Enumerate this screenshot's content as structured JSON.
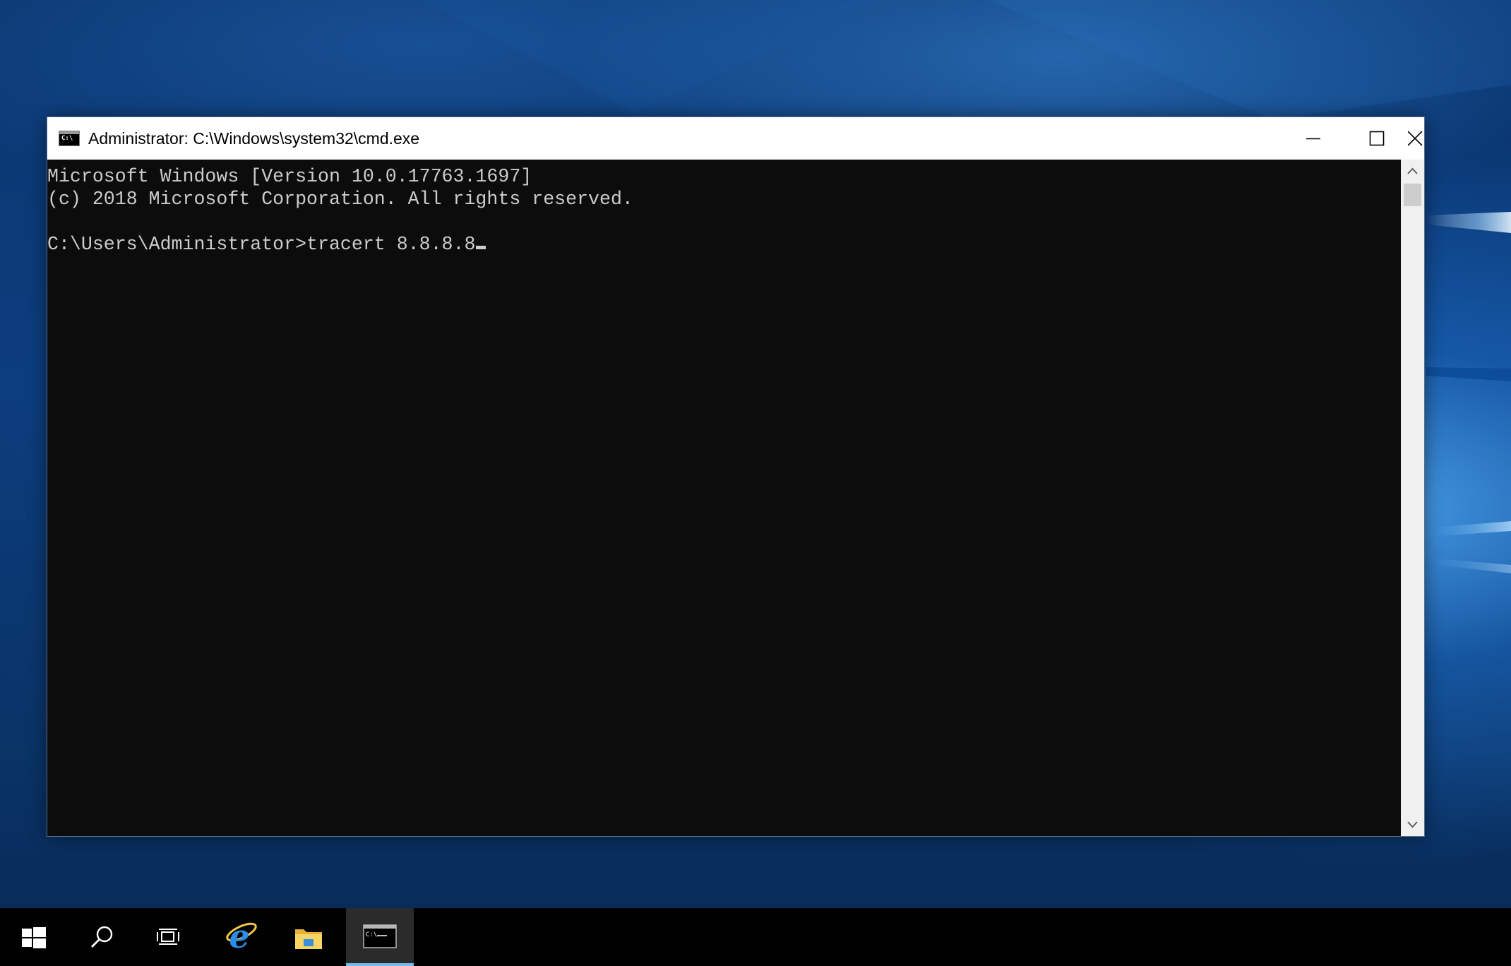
{
  "window": {
    "title": "Administrator: C:\\Windows\\system32\\cmd.exe",
    "icon": "cmd-icon",
    "icon_label": "C:\\",
    "controls": {
      "minimize": "minimize-icon",
      "maximize": "maximize-icon",
      "close": "close-icon"
    }
  },
  "console": {
    "lines": [
      "Microsoft Windows [Version 10.0.17763.1697]",
      "(c) 2018 Microsoft Corporation. All rights reserved.",
      "",
      "C:\\Users\\Administrator>tracert 8.8.8.8"
    ],
    "text_color": "#cccccc",
    "background": "#0c0c0c"
  },
  "taskbar": {
    "items": [
      {
        "name": "start",
        "icon": "windows-logo-icon"
      },
      {
        "name": "search",
        "icon": "search-icon"
      },
      {
        "name": "task-view",
        "icon": "task-view-icon"
      },
      {
        "name": "internet-explorer",
        "icon": "internet-explorer-icon"
      },
      {
        "name": "file-explorer",
        "icon": "folder-icon"
      },
      {
        "name": "command-prompt",
        "icon": "cmd-icon",
        "active": true
      }
    ],
    "accent": "#76b9ed"
  }
}
